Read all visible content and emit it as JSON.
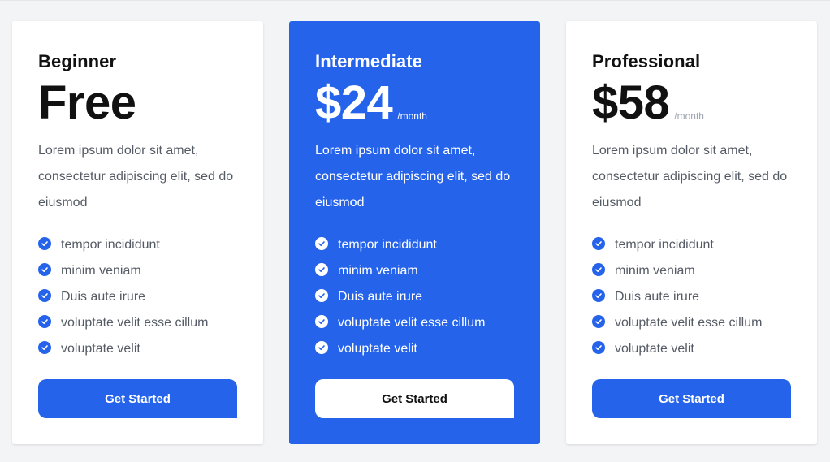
{
  "colors": {
    "accent": "#2563eb",
    "text_muted": "#555b65",
    "period": "#9ca3af"
  },
  "plans": [
    {
      "name": "Beginner",
      "price": "Free",
      "period": "",
      "description": "Lorem ipsum dolor sit amet, consectetur adipiscing elit, sed do eiusmod",
      "features": [
        "tempor incididunt",
        "minim veniam",
        "Duis aute irure",
        "voluptate velit esse cillum",
        "voluptate velit"
      ],
      "button_label": "Get Started",
      "feature_icon": "check-circle-icon"
    },
    {
      "name": "Intermediate",
      "price": "$24",
      "period": "/month",
      "description": "Lorem ipsum dolor sit amet, consectetur adipiscing elit, sed do eiusmod",
      "features": [
        "tempor incididunt",
        "minim veniam",
        "Duis aute irure",
        "voluptate velit esse cillum",
        "voluptate velit"
      ],
      "button_label": "Get Started",
      "feature_icon": "check-circle-icon"
    },
    {
      "name": "Professional",
      "price": "$58",
      "period": "/month",
      "description": "Lorem ipsum dolor sit amet, consectetur adipiscing elit, sed do eiusmod",
      "features": [
        "tempor incididunt",
        "minim veniam",
        "Duis aute irure",
        "voluptate velit esse cillum",
        "voluptate velit"
      ],
      "button_label": "Get Started",
      "feature_icon": "check-circle-icon"
    }
  ]
}
